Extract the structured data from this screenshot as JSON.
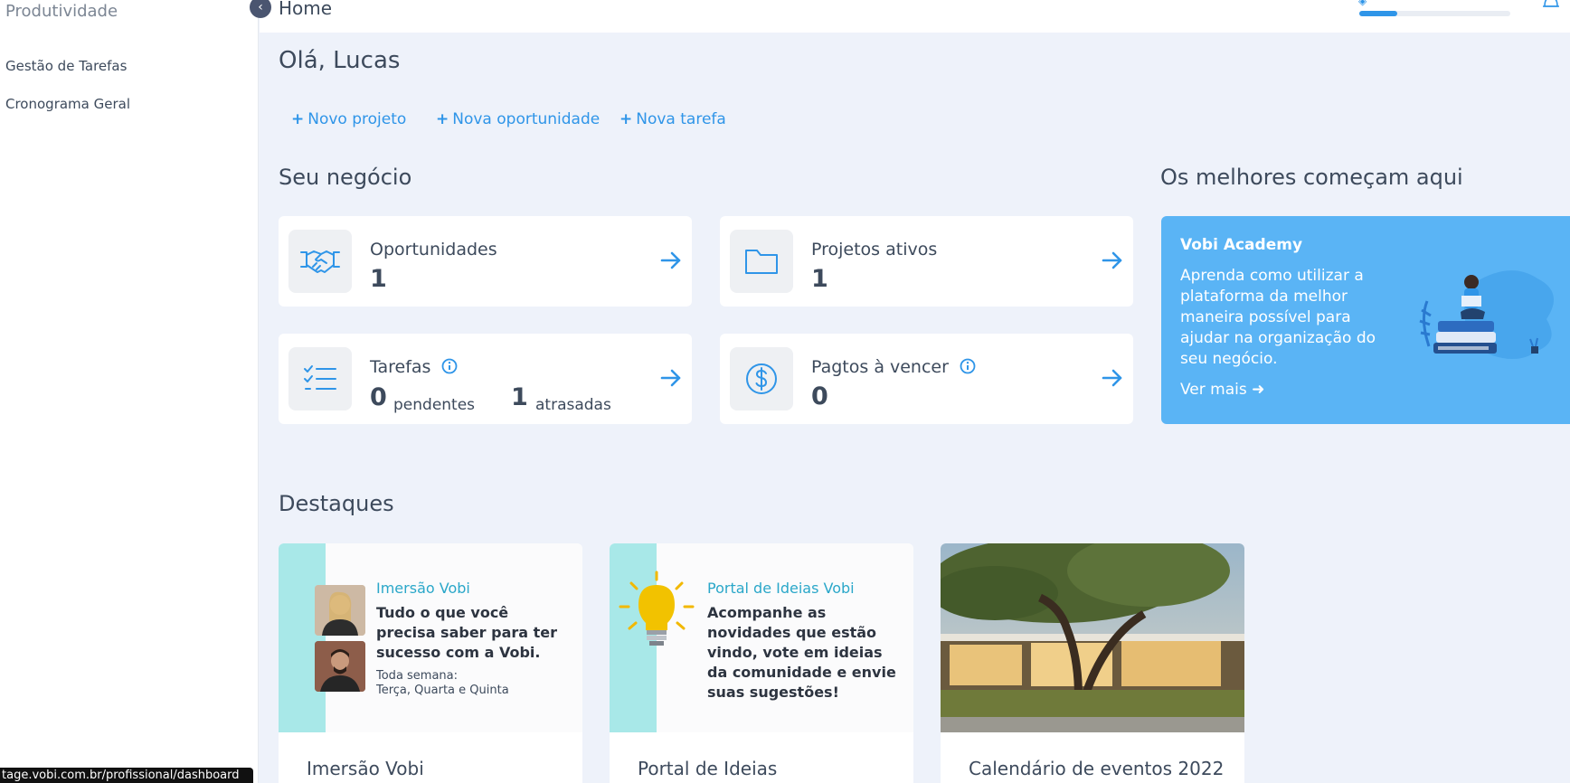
{
  "sidebar": {
    "section_title": "Produtividade",
    "items": [
      {
        "label": "Gestão de Tarefas"
      },
      {
        "label": "Cronograma Geral"
      }
    ]
  },
  "status_url": "tage.vobi.com.br/profissional/dashboard",
  "topbar": {
    "breadcrumb": "Home",
    "onboarding_progress_fraction": 0.25
  },
  "greeting": "Olá, Lucas",
  "quick_actions": [
    {
      "label": "Novo projeto"
    },
    {
      "label": "Nova oportunidade"
    },
    {
      "label": "Nova tarefa"
    }
  ],
  "business": {
    "title": "Seu negócio",
    "opportunities": {
      "label": "Oportunidades",
      "value": "1",
      "icon": "handshake-icon"
    },
    "active_projects": {
      "label": "Projetos ativos",
      "value": "1",
      "icon": "folder-icon"
    },
    "tasks": {
      "label": "Tarefas",
      "pending_value": "0",
      "pending_label": "pendentes",
      "late_value": "1",
      "late_label": "atrasadas",
      "icon": "checklist-icon"
    },
    "payments": {
      "label": "Pagtos à vencer",
      "value": "0",
      "icon": "dollar-circle-icon"
    }
  },
  "best": {
    "title": "Os melhores começam aqui",
    "academy": {
      "title": "Vobi Academy",
      "text": "Aprenda como utilizar a plataforma da melhor maneira possível para ajudar na organização do seu negócio.",
      "link": "Ver mais"
    }
  },
  "highlights": {
    "title": "Destaques",
    "cards": [
      {
        "caption": "Imersão Vobi",
        "banner_tag": "Imersão Vobi",
        "banner_head": "Tudo o que você precisa saber para ter sucesso com a Vobi.",
        "banner_note_1": "Toda semana:",
        "banner_note_2": "Terça, Quarta e Quinta"
      },
      {
        "caption": "Portal de Ideias",
        "banner_tag": "Portal de Ideias Vobi",
        "banner_head": "Acompanhe as novidades que estão vindo, vote em ideias da comunidade e envie suas sugestões!"
      },
      {
        "caption": "Calendário de eventos 2022"
      }
    ]
  },
  "colors": {
    "accent": "#2f95e8",
    "academy_bg": "#5ab4f5",
    "page_bg": "#eef2fa",
    "teal_band": "#a8e8e8"
  }
}
